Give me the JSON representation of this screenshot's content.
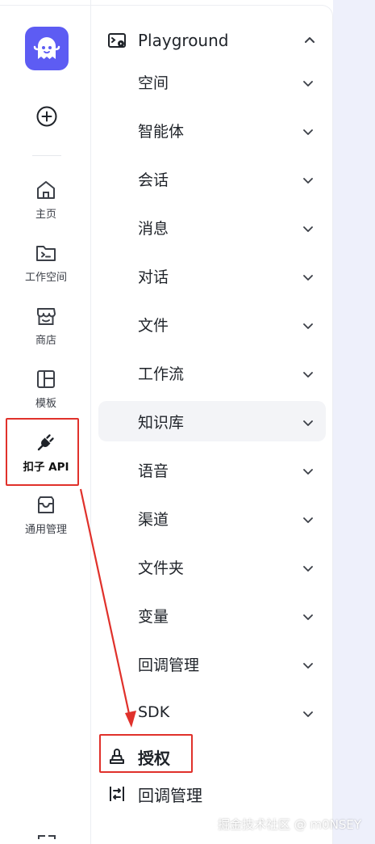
{
  "sidebar": {
    "items": [
      {
        "label": "主页",
        "icon": "home-icon"
      },
      {
        "label": "工作空间",
        "icon": "workspace-folder-icon"
      },
      {
        "label": "商店",
        "icon": "store-icon"
      },
      {
        "label": "模板",
        "icon": "template-icon"
      },
      {
        "label": "扣子 API",
        "icon": "plug-api-icon",
        "active": true
      },
      {
        "label": "通用管理",
        "icon": "inbox-management-icon"
      }
    ]
  },
  "tree": {
    "header": {
      "label": "Playground",
      "icon": "playground-icon",
      "expanded": true
    },
    "items": [
      {
        "label": "空间"
      },
      {
        "label": "智能体"
      },
      {
        "label": "会话"
      },
      {
        "label": "消息"
      },
      {
        "label": "对话"
      },
      {
        "label": "文件"
      },
      {
        "label": "工作流"
      },
      {
        "label": "知识库",
        "selected": true
      },
      {
        "label": "语音"
      },
      {
        "label": "渠道"
      },
      {
        "label": "文件夹"
      },
      {
        "label": "变量"
      },
      {
        "label": "回调管理"
      },
      {
        "label": "SDK"
      }
    ],
    "leaves": [
      {
        "label": "授权",
        "icon": "authorization-stamp-icon"
      },
      {
        "label": "回调管理",
        "icon": "callback-icon"
      }
    ]
  },
  "annotation": {
    "color": "#e0312b"
  },
  "watermark": "掘金技术社区 @ m0NSEY",
  "colors": {
    "brand": "#5d5cf3",
    "selected_bg": "#f3f4f7",
    "page_bg": "#eef0fb"
  }
}
